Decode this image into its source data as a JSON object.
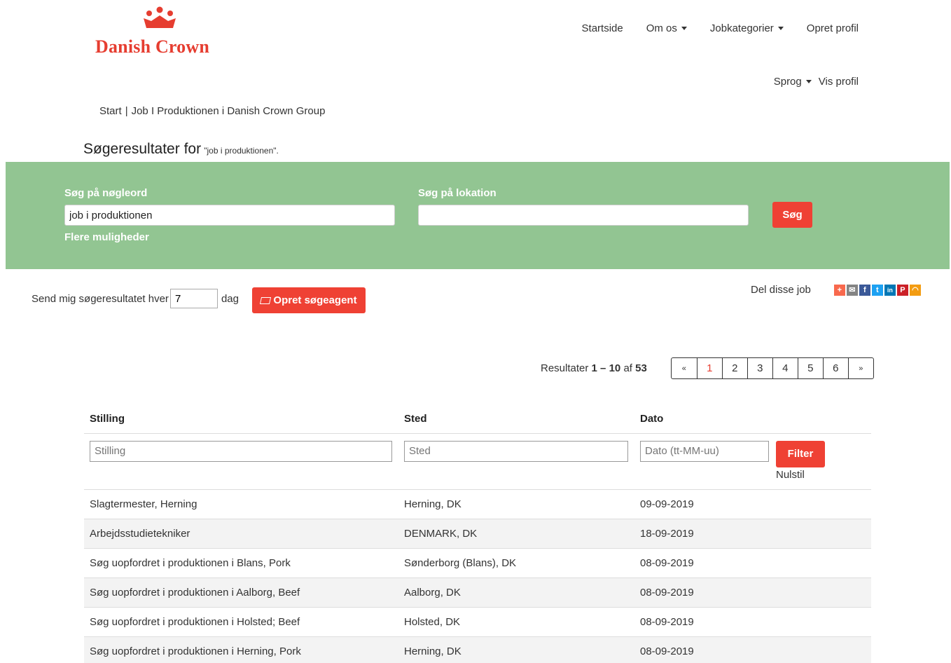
{
  "brand": {
    "name": "Danish Crown",
    "color": "#e63d30"
  },
  "nav": {
    "items": [
      {
        "label": "Startside",
        "dropdown": false
      },
      {
        "label": "Om os",
        "dropdown": true
      },
      {
        "label": "Jobkategorier",
        "dropdown": true
      },
      {
        "label": "Opret profil",
        "dropdown": false
      }
    ],
    "sub_items": [
      {
        "label": "Sprog",
        "dropdown": true
      },
      {
        "label": "Vis profil",
        "dropdown": false
      }
    ]
  },
  "breadcrumb": {
    "home": "Start",
    "separator": "|",
    "current": "Job I Produktionen i Danish Crown Group"
  },
  "results_heading": {
    "prefix": "Søgeresultater for",
    "query": "\"job i produktionen\"."
  },
  "search": {
    "keyword_label": "Søg på nøgleord",
    "keyword_value": "job i produktionen",
    "location_label": "Søg på lokation",
    "location_value": "",
    "more_options": "Flere muligheder",
    "button": "Søg",
    "panel_color": "#92c592"
  },
  "agent": {
    "text_before": "Send mig søgeresultatet hver",
    "days_value": "7",
    "text_after": "dag",
    "button": "Opret søgeagent"
  },
  "share": {
    "label": "Del disse job",
    "icons": [
      {
        "name": "addthis-plus-icon",
        "glyph": "+",
        "color": "#f8694d"
      },
      {
        "name": "email-icon",
        "glyph": "✉",
        "color": "#848484"
      },
      {
        "name": "facebook-icon",
        "glyph": "f",
        "color": "#3b5998"
      },
      {
        "name": "twitter-icon",
        "glyph": "t",
        "color": "#1da1f2"
      },
      {
        "name": "linkedin-icon",
        "glyph": "in",
        "color": "#0077b5"
      },
      {
        "name": "pinterest-icon",
        "glyph": "P",
        "color": "#cb2027"
      },
      {
        "name": "rss-icon",
        "glyph": "◠",
        "color": "#f39c12"
      }
    ]
  },
  "pagination": {
    "label_prefix": "Resultater",
    "range": "1 – 10",
    "label_of": "af",
    "total": "53",
    "prev": "«",
    "next": "»",
    "pages": [
      "1",
      "2",
      "3",
      "4",
      "5",
      "6"
    ],
    "current": "1"
  },
  "table": {
    "headers": {
      "title": "Stilling",
      "location": "Sted",
      "date": "Dato"
    },
    "filters": {
      "title_placeholder": "Stilling",
      "location_placeholder": "Sted",
      "date_placeholder": "Dato (tt-MM-uu)",
      "filter_button": "Filter",
      "reset": "Nulstil"
    },
    "rows": [
      {
        "title": "Slagtermester, Herning",
        "location": "Herning, DK",
        "date": "09-09-2019"
      },
      {
        "title": "Arbejdsstudietekniker",
        "location": "DENMARK, DK",
        "date": "18-09-2019"
      },
      {
        "title": "Søg uopfordret i produktionen i Blans, Pork",
        "location": "Sønderborg (Blans), DK",
        "date": "08-09-2019"
      },
      {
        "title": "Søg uopfordret i produktionen i Aalborg, Beef",
        "location": "Aalborg, DK",
        "date": "08-09-2019"
      },
      {
        "title": "Søg uopfordret i produktionen i Holsted; Beef",
        "location": "Holsted, DK",
        "date": "08-09-2019"
      },
      {
        "title": "Søg uopfordret i produktionen i Herning, Pork",
        "location": "Herning, DK",
        "date": "08-09-2019"
      }
    ]
  }
}
